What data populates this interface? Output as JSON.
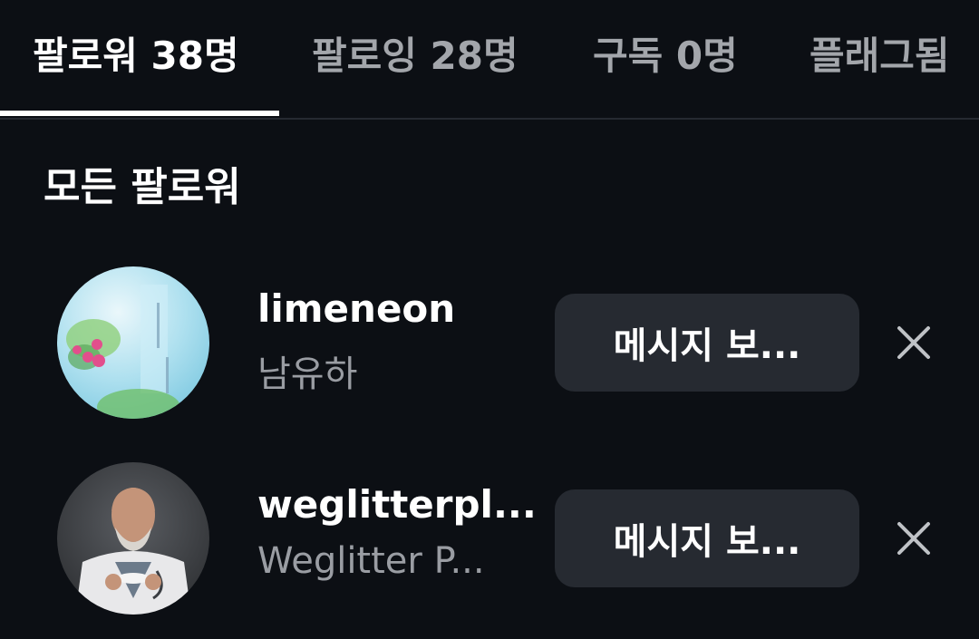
{
  "tabs": [
    {
      "label": "팔로워 38명",
      "active": true
    },
    {
      "label": "팔로잉 28명",
      "active": false
    },
    {
      "label": "구독 0명",
      "active": false
    },
    {
      "label": "플래그됨",
      "active": false
    }
  ],
  "section_title": "모든 팔로워",
  "followers": [
    {
      "username": "limeneon",
      "fullname": "남유하",
      "button_label": "메시지 보...",
      "avatar_icon": "watercolor-book-cover-avatar"
    },
    {
      "username": "weglitterpl...",
      "fullname": "Weglitter P...",
      "button_label": "메시지 보...",
      "avatar_icon": "doctor-portrait-avatar"
    }
  ],
  "colors": {
    "background": "#0c0f14",
    "button": "#262a31",
    "secondary_text": "#9a9da3",
    "active_tab": "#ffffff"
  }
}
